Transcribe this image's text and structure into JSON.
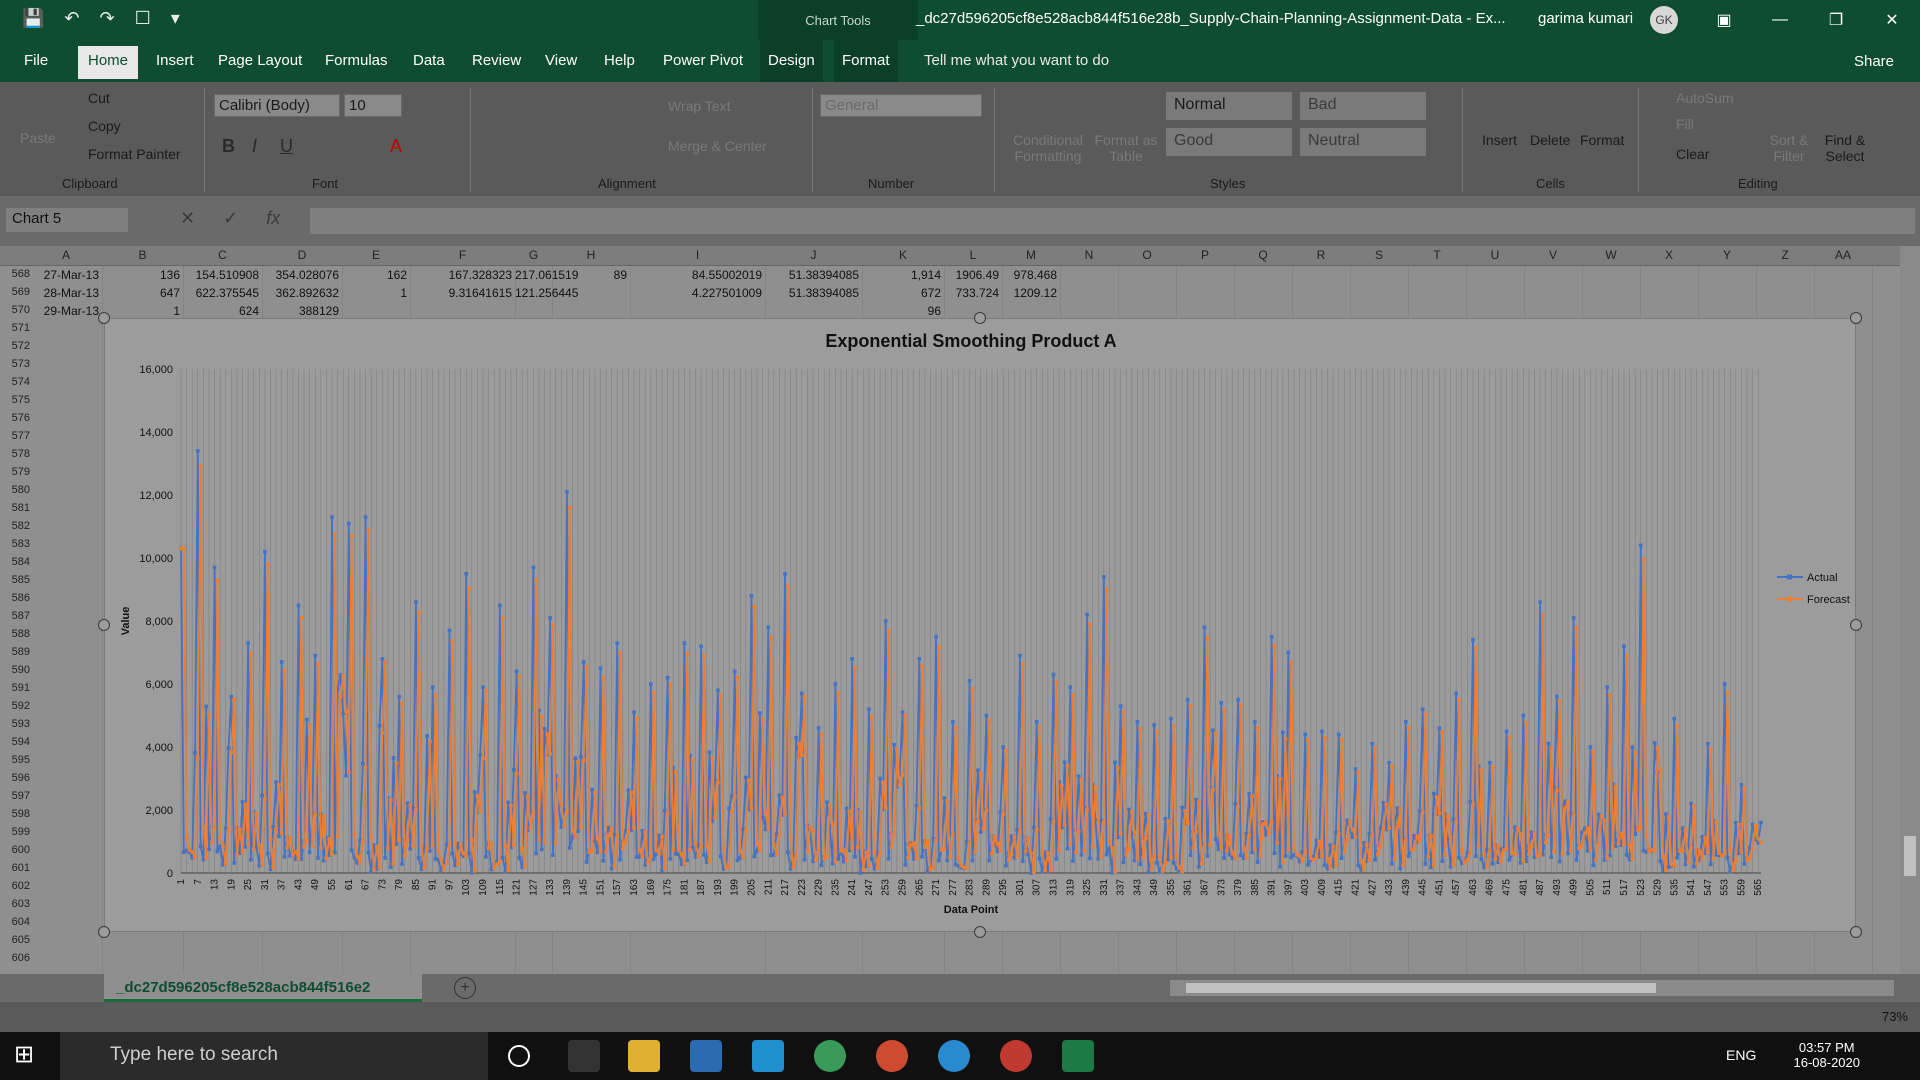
{
  "titlebar": {
    "context_tab": "Chart Tools",
    "doc_title": "_dc27d596205cf8e528acb844f516e28b_Supply-Chain-Planning-Assignment-Data  -  Ex...",
    "user": "garima kumari",
    "avatar": "GK",
    "qat_icons": [
      "save-icon",
      "undo-icon",
      "redo-icon",
      "touch-icon",
      "customize-icon"
    ]
  },
  "menu": {
    "tabs": [
      "File",
      "Home",
      "Insert",
      "Page Layout",
      "Formulas",
      "Data",
      "Review",
      "View",
      "Help",
      "Power Pivot",
      "Design",
      "Format"
    ],
    "active": "Home",
    "tell_me": "Tell me what you want to do",
    "share": "Share"
  },
  "ribbon": {
    "clipboard": {
      "paste": "Paste",
      "cut": "Cut",
      "copy": "Copy",
      "format_painter": "Format Painter",
      "label": "Clipboard"
    },
    "font": {
      "name": "Calibri (Body)",
      "size": "10",
      "label": "Font"
    },
    "alignment": {
      "wrap": "Wrap Text",
      "merge": "Merge & Center",
      "label": "Alignment"
    },
    "number": {
      "format": "General",
      "label": "Number"
    },
    "styles": {
      "conditional": "Conditional Formatting",
      "format_table": "Format as Table",
      "cells": [
        "Normal",
        "Bad",
        "Good",
        "Neutral"
      ],
      "label": "Styles"
    },
    "cells": {
      "insert": "Insert",
      "delete": "Delete",
      "format": "Format",
      "label": "Cells"
    },
    "editing": {
      "autosum": "AutoSum",
      "fill": "Fill",
      "clear": "Clear",
      "sort": "Sort & Filter",
      "find": "Find & Select",
      "label": "Editing"
    }
  },
  "formula": {
    "namebox": "Chart 5",
    "fx": "fx",
    "value": ""
  },
  "columns": [
    "A",
    "B",
    "C",
    "D",
    "E",
    "F",
    "G",
    "H",
    "I",
    "J",
    "K",
    "L",
    "M",
    "N",
    "O",
    "P",
    "Q",
    "R",
    "S",
    "T",
    "U",
    "V",
    "W",
    "X",
    "Y",
    "Z",
    "AA"
  ],
  "rows": [
    {
      "num": "568",
      "A": "27-Mar-13",
      "B": "136",
      "C": "154.510908",
      "D": "354.028076",
      "E": "162",
      "F": "167.328323",
      "G": "217.061519",
      "H": "89",
      "I": "84.55002019",
      "J": "51.38394085",
      "K": "1,914",
      "L": "1906.49",
      "M": "978.468"
    },
    {
      "num": "569",
      "A": "28-Mar-13",
      "B": "647",
      "C": "622.375545",
      "D": "362.892632",
      "E": "1",
      "F": "9.31641615",
      "G": "121.256445",
      "H": "",
      "I": "4.227501009",
      "J": "51.38394085",
      "K": "672",
      "L": "733.724",
      "M": "1209.12"
    },
    {
      "num": "570",
      "A": "29-Mar-13",
      "B": "1",
      "C": "624",
      "D": "388129",
      "E": "",
      "F": "",
      "G": "",
      "H": "",
      "I": "",
      "J": "",
      "K": "96",
      "L": "",
      "M": ""
    }
  ],
  "row_numbers": [
    "571",
    "572",
    "573",
    "574",
    "575",
    "576",
    "577",
    "578",
    "579",
    "580",
    "581",
    "582",
    "583",
    "584",
    "585",
    "586",
    "587",
    "588",
    "589",
    "590",
    "591",
    "592",
    "593",
    "594",
    "595",
    "596",
    "597",
    "598",
    "599",
    "600",
    "601",
    "602",
    "603",
    "604",
    "605",
    "606"
  ],
  "chart_data": {
    "type": "line",
    "title": "Exponential Smoothing Product A",
    "xlabel": "Data Point",
    "ylabel": "Value",
    "ylim": [
      0,
      16000
    ],
    "yticks": [
      "0",
      "2,000",
      "4,000",
      "6,000",
      "8,000",
      "10,000",
      "12,000",
      "14,000",
      "16,000"
    ],
    "x_start": 1,
    "x_end": 566,
    "x_tick_step": 6,
    "legend": "right",
    "series": [
      {
        "name": "Actual",
        "color": "#4472c4"
      },
      {
        "name": "Forecast",
        "color": "#ed7d31"
      }
    ],
    "peaks_actual": [
      [
        1,
        10300
      ],
      [
        7,
        13400
      ],
      [
        13,
        9700
      ],
      [
        19,
        5600
      ],
      [
        25,
        7300
      ],
      [
        31,
        10200
      ],
      [
        37,
        6700
      ],
      [
        43,
        8500
      ],
      [
        49,
        6900
      ],
      [
        55,
        11300
      ],
      [
        61,
        11100
      ],
      [
        67,
        11300
      ],
      [
        73,
        6800
      ],
      [
        79,
        5600
      ],
      [
        85,
        8600
      ],
      [
        91,
        5900
      ],
      [
        97,
        7700
      ],
      [
        103,
        9500
      ],
      [
        109,
        5900
      ],
      [
        115,
        8500
      ],
      [
        121,
        6400
      ],
      [
        127,
        9700
      ],
      [
        133,
        8100
      ],
      [
        139,
        12100
      ],
      [
        145,
        6700
      ],
      [
        151,
        6500
      ],
      [
        157,
        7300
      ],
      [
        163,
        5100
      ],
      [
        169,
        6000
      ],
      [
        175,
        6200
      ],
      [
        181,
        7300
      ],
      [
        187,
        7200
      ],
      [
        193,
        5800
      ],
      [
        199,
        6400
      ],
      [
        205,
        8800
      ],
      [
        211,
        7800
      ],
      [
        217,
        9500
      ],
      [
        223,
        5700
      ],
      [
        229,
        4600
      ],
      [
        235,
        6000
      ],
      [
        241,
        6800
      ],
      [
        247,
        5200
      ],
      [
        253,
        8000
      ],
      [
        259,
        5100
      ],
      [
        265,
        6800
      ],
      [
        271,
        7500
      ],
      [
        277,
        4800
      ],
      [
        283,
        6100
      ],
      [
        289,
        5000
      ],
      [
        295,
        4000
      ],
      [
        301,
        6900
      ],
      [
        307,
        4800
      ],
      [
        313,
        6300
      ],
      [
        319,
        5900
      ],
      [
        325,
        8200
      ],
      [
        331,
        9400
      ],
      [
        337,
        5300
      ],
      [
        343,
        4800
      ],
      [
        349,
        4700
      ],
      [
        355,
        4900
      ],
      [
        361,
        5500
      ],
      [
        367,
        7800
      ],
      [
        373,
        5400
      ],
      [
        379,
        5500
      ],
      [
        385,
        4800
      ],
      [
        391,
        7500
      ],
      [
        397,
        7000
      ],
      [
        403,
        4400
      ],
      [
        409,
        4500
      ],
      [
        415,
        4400
      ],
      [
        421,
        3300
      ],
      [
        427,
        4100
      ],
      [
        433,
        3500
      ],
      [
        439,
        4800
      ],
      [
        445,
        5200
      ],
      [
        451,
        4600
      ],
      [
        457,
        5700
      ],
      [
        463,
        7400
      ],
      [
        469,
        3500
      ],
      [
        475,
        4500
      ],
      [
        481,
        5000
      ],
      [
        487,
        8600
      ],
      [
        493,
        5600
      ],
      [
        499,
        8100
      ],
      [
        505,
        4000
      ],
      [
        511,
        5900
      ],
      [
        517,
        7200
      ],
      [
        523,
        10400
      ],
      [
        529,
        3200
      ],
      [
        535,
        4900
      ],
      [
        541,
        2200
      ],
      [
        547,
        4100
      ],
      [
        553,
        6000
      ],
      [
        559,
        2800
      ],
      [
        566,
        1600
      ]
    ],
    "note_forecast": "Forecast closely tracks Actual, lagged by one period, peaks slightly lower"
  },
  "sheet": {
    "tab": "_dc27d596205cf8e528acb844f516e2",
    "add": "+"
  },
  "status": {
    "zoom": "73%"
  },
  "taskbar": {
    "search": "Type here to search",
    "lang": "ENG",
    "time": "03:57 PM",
    "date": "16-08-2020"
  }
}
